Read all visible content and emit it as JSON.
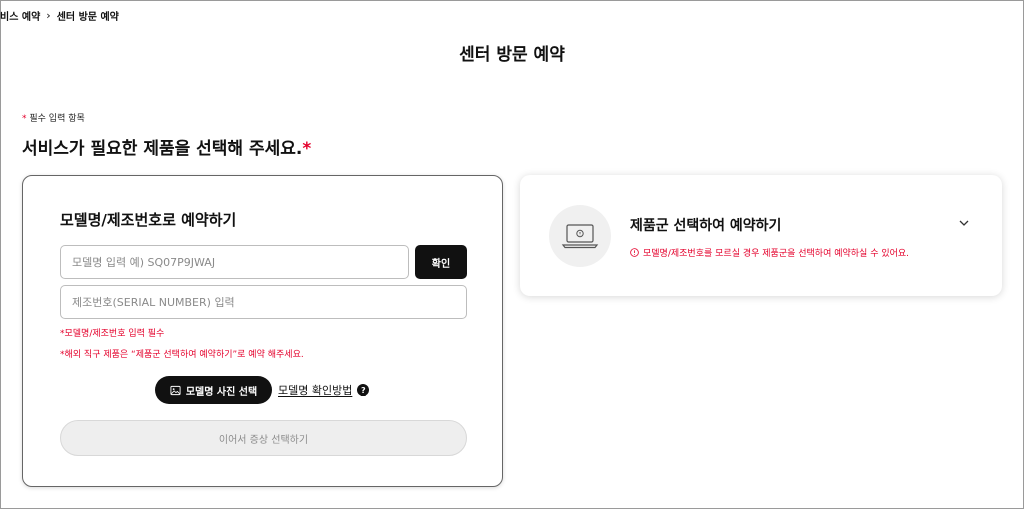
{
  "breadcrumb": {
    "parent": "비스 예약",
    "separator": "›",
    "current": "센터 방문 예약"
  },
  "page_title": "센터 방문 예약",
  "required_note": {
    "star": "*",
    "text": "필수 입력 항목"
  },
  "section_title": {
    "text": "서비스가 필요한 제품을 선택해 주세요.",
    "star": "*"
  },
  "model_card": {
    "title": "모델명/제조번호로 예약하기",
    "model_input_placeholder": "모델명 입력 예) SQ07P9JWAJ",
    "model_input_value": "",
    "confirm_label": "확인",
    "serial_input_placeholder": "제조번호(SERIAL NUMBER) 입력",
    "serial_input_value": "",
    "hint_required": "*모델명/제조번호 입력 필수",
    "hint_overseas": "*해외 직구 제품은 “제품군 선택하여 예약하기”로 예약 해주세요.",
    "photo_button_label": "모델명 사진 선택",
    "photo_icon": "image-icon",
    "howto_link_label": "모델명 확인방법",
    "help_icon_glyph": "?",
    "next_button_label": "이어서 증상 선택하기"
  },
  "category_card": {
    "icon": "laptop-icon",
    "title": "제품군 선택하여 예약하기",
    "description": "모델명/제조번호를 모르실 경우 제품군을 선택하여 예약하실 수 있어요.",
    "expand_icon": "chevron-down-icon"
  },
  "colors": {
    "accent_red": "#e4002b",
    "primary_black": "#111111",
    "disabled_gray": "#eeeeee"
  }
}
